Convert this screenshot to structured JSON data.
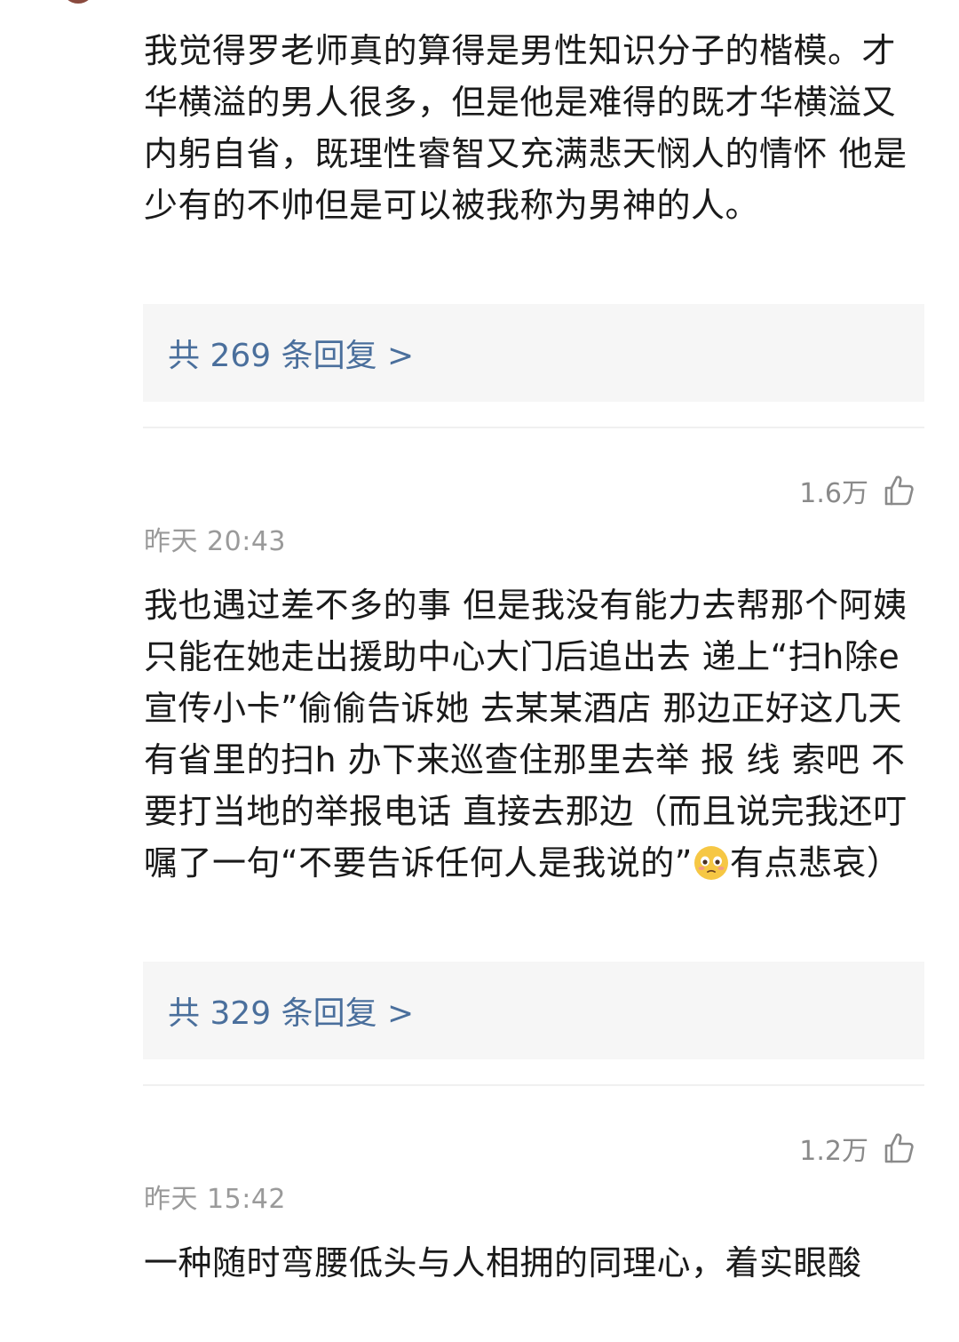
{
  "comments": [
    {
      "text": "我觉得罗老师真的算得是男性知识分子的楷模。才华横溢的男人很多，但是他是难得的既才华横溢又内躬自省，既理性睿智又充满悲天悯人的情怀 他是少有的不帅但是可以被我称为男神的人。",
      "replies_label": "共 269 条回复 >"
    },
    {
      "likes": "1.6万",
      "time": "昨天 20:43",
      "text_before_emoji": "我也遇过差不多的事 但是我没有能力去帮那个阿姨 只能在她走出援助中心大门后追出去 递上“扫h除e宣传小卡”偷偷告诉她 去某某酒店 那边正好这几天有省里的扫h 办下来巡查住那里去举 报 线 索吧 不要打当地的举报电话 直接去那边（而且说完我还叮嘱了一句“不要告诉任何人是我说的”",
      "emoji": "flushed-face-icon",
      "text_after_emoji": "有点悲哀）",
      "replies_label": "共 329 条回复 >"
    },
    {
      "likes": "1.2万",
      "time": "昨天 15:42",
      "text": "一种随时弯腰低头与人相拥的同理心，着实眼酸"
    }
  ],
  "colors": {
    "link": "#4a6f9c",
    "meta": "#9a9a9a",
    "reply_bg": "#f6f6f6"
  }
}
